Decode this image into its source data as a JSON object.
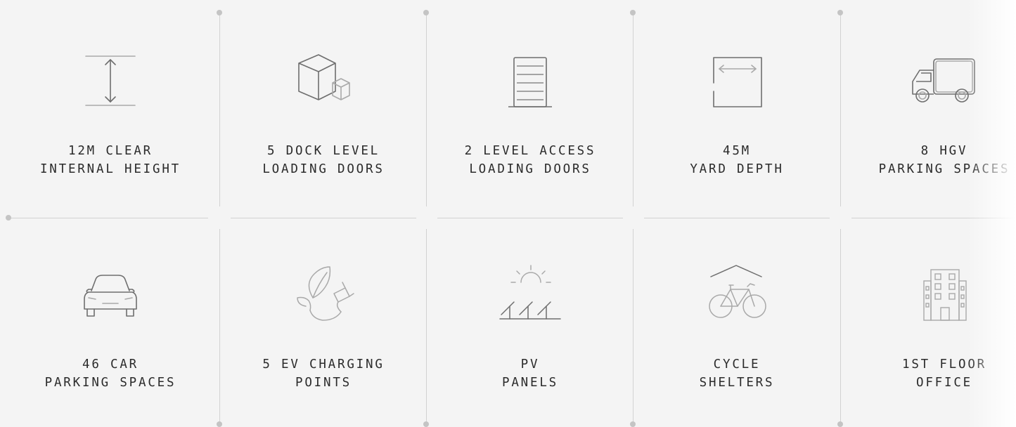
{
  "features": [
    {
      "icon": "height-arrows-icon",
      "line1": "12M CLEAR",
      "line2": "INTERNAL HEIGHT"
    },
    {
      "icon": "boxes-icon",
      "line1": "5 DOCK LEVEL",
      "line2": "LOADING DOORS"
    },
    {
      "icon": "roller-door-icon",
      "line1": "2 LEVEL ACCESS",
      "line2": "LOADING DOORS"
    },
    {
      "icon": "yard-depth-icon",
      "line1": "45M",
      "line2": "YARD DEPTH"
    },
    {
      "icon": "truck-icon",
      "line1": "8 HGV",
      "line2": "PARKING SPACES"
    },
    {
      "icon": "car-icon",
      "line1": "46 CAR",
      "line2": "PARKING SPACES"
    },
    {
      "icon": "ev-leaf-plug-icon",
      "line1": "5 EV CHARGING",
      "line2": "POINTS"
    },
    {
      "icon": "solar-panel-icon",
      "line1": "PV",
      "line2": "PANELS"
    },
    {
      "icon": "bicycle-shelter-icon",
      "line1": "CYCLE",
      "line2": "SHELTERS"
    },
    {
      "icon": "office-building-icon",
      "line1": "1ST FLOOR",
      "line2": "OFFICE"
    }
  ],
  "colors": {
    "background": "#f4f4f4",
    "text": "#2b2b2b",
    "divider": "#d2d2d2",
    "icon_dark": "#6e6e6e",
    "icon_light": "#a9a9a9"
  }
}
